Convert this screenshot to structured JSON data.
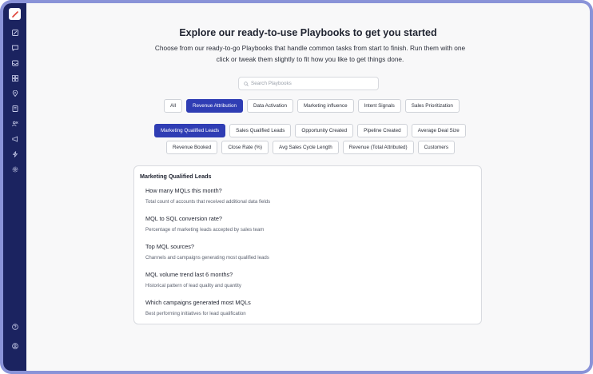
{
  "header": {
    "title": "Explore our ready-to-use Playbooks to get you started",
    "subtitle": "Choose from our ready-to-go Playbooks that handle common tasks from start to finish. Run them with one click or tweak them slightly to fit how you like to get things done."
  },
  "search": {
    "placeholder": "Search Playbooks"
  },
  "categories": [
    {
      "label": "All",
      "active": false
    },
    {
      "label": "Revenue Attribution",
      "active": true
    },
    {
      "label": "Data Activation",
      "active": false
    },
    {
      "label": "Marketing influence",
      "active": false
    },
    {
      "label": "Intent Signals",
      "active": false
    },
    {
      "label": "Sales Prioritization",
      "active": false
    }
  ],
  "subcategories_row1": [
    {
      "label": "Marketing Qualified Leads",
      "active": true
    },
    {
      "label": "Sales Qualified Leads",
      "active": false
    },
    {
      "label": "Opportunity Created",
      "active": false
    },
    {
      "label": "Pipeline Created",
      "active": false
    },
    {
      "label": "Average Deal Size",
      "active": false
    }
  ],
  "subcategories_row2": [
    {
      "label": "Revenue Booked",
      "active": false
    },
    {
      "label": "Close Rate (%)",
      "active": false
    },
    {
      "label": "Avg Sales Cycle Length",
      "active": false
    },
    {
      "label": "Revenue (Total Attributed)",
      "active": false
    },
    {
      "label": "Customers",
      "active": false
    }
  ],
  "card": {
    "title": "Marketing Qualified Leads",
    "questions": [
      {
        "title": "How many MQLs this month?",
        "desc": "Total count of accounts that received additional data fields"
      },
      {
        "title": "MQL to SQL conversion rate?",
        "desc": "Percentage of marketing leads accepted by sales team"
      },
      {
        "title": "Top MQL sources?",
        "desc": "Channels and campaigns generating most qualified leads"
      },
      {
        "title": "MQL volume trend last 6 months?",
        "desc": "Historical pattern of lead quality and quantity"
      },
      {
        "title": "Which campaigns generated most MQLs",
        "desc": "Best performing initiatives for lead qualification"
      }
    ]
  },
  "sidebar": {
    "icons": [
      "edit-icon",
      "chat-icon",
      "inbox-icon",
      "grid-icon",
      "location-pin-icon",
      "book-icon",
      "users-icon",
      "megaphone-icon",
      "bolt-icon",
      "settings-icon"
    ],
    "bottom_icons": [
      "help-icon",
      "account-icon"
    ]
  },
  "colors": {
    "accent": "#2f3db4",
    "sidebar": "#1b2360",
    "frame": "#8a93d8"
  }
}
